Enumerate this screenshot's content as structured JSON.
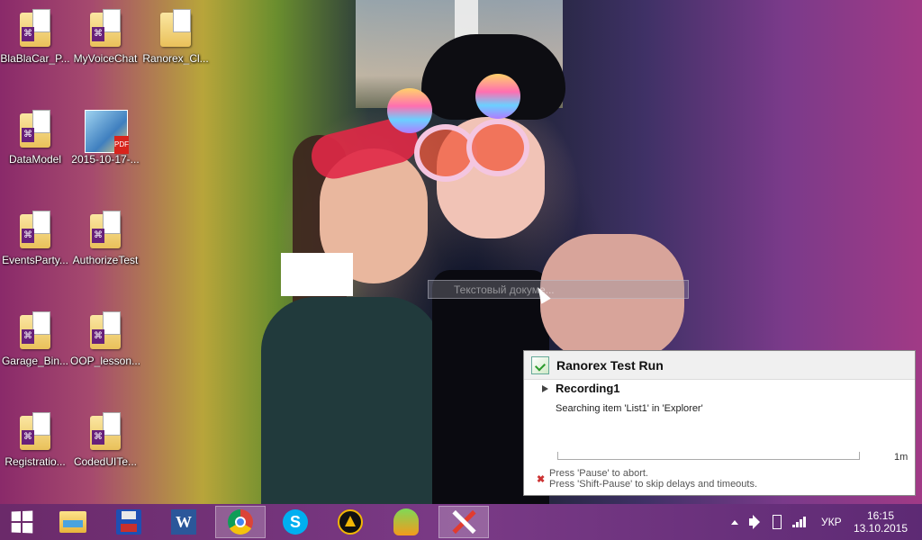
{
  "desktop": {
    "icons": [
      {
        "label": "BlaBlaCar_P...",
        "type": "vs-folder"
      },
      {
        "label": "MyVoiceChat",
        "type": "vs-folder"
      },
      {
        "label": "Ranorex_Cl...",
        "type": "folder"
      },
      {
        "label": "DataModel",
        "type": "vs-folder"
      },
      {
        "label": "2015-10-17-...",
        "type": "pdf-image"
      },
      {
        "label": "EventsParty...",
        "type": "vs-folder"
      },
      {
        "label": "AuthorizeTest",
        "type": "vs-folder"
      },
      {
        "label": "Garage_Bin...",
        "type": "vs-folder"
      },
      {
        "label": "OOP_lesson...",
        "type": "vs-folder"
      },
      {
        "label": "Registratio...",
        "type": "vs-folder"
      },
      {
        "label": "CodedUITe...",
        "type": "vs-folder"
      }
    ],
    "drag_tooltip": "Текстовый докуме..."
  },
  "ranorex": {
    "title": "Ranorex Test Run",
    "recording": "Recording1",
    "status": "Searching item 'List1' in 'Explorer'",
    "progress": 0.0,
    "eta": "1m",
    "hint_line1": "Press 'Pause' to abort.",
    "hint_line2": "Press 'Shift-Pause' to skip delays and timeouts."
  },
  "taskbar": {
    "apps": [
      {
        "name": "start",
        "icon": "windows-logo-icon"
      },
      {
        "name": "file-explorer",
        "icon": "folder-icon"
      },
      {
        "name": "save",
        "icon": "floppy-disk-icon"
      },
      {
        "name": "word",
        "icon": "word-icon",
        "glyph": "W"
      },
      {
        "name": "chrome",
        "icon": "chrome-icon",
        "active": true
      },
      {
        "name": "skype",
        "icon": "skype-icon",
        "glyph": "S"
      },
      {
        "name": "aimp",
        "icon": "aimp-icon"
      },
      {
        "name": "fl-studio",
        "icon": "fl-studio-icon"
      },
      {
        "name": "ranorex",
        "icon": "ranorex-icon",
        "active": true
      }
    ],
    "tray": {
      "language": "УКР",
      "time": "16:15",
      "date": "13.10.2015"
    }
  }
}
